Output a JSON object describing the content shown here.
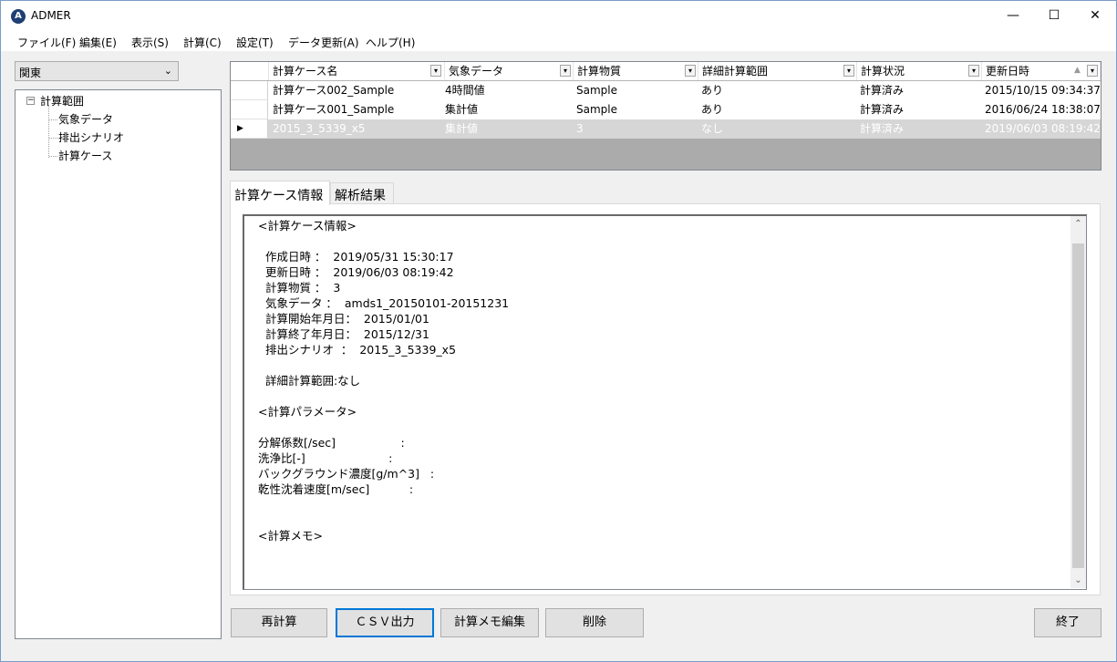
{
  "window": {
    "title": "ADMER",
    "app_icon": "A",
    "controls": {
      "minimize": "—",
      "maximize": "☐",
      "close": "✕"
    }
  },
  "menu": [
    "ファイル(F)",
    "編集(E)",
    "表示(S)",
    "計算(C)",
    "設定(T)",
    "データ更新(A)",
    "ヘルプ(H)"
  ],
  "region_select": {
    "value": "関東"
  },
  "tree": {
    "root": "計算範囲",
    "expander": "−",
    "children": [
      "気象データ",
      "排出シナリオ",
      "計算ケース"
    ]
  },
  "grid": {
    "columns": [
      "計算ケース名",
      "気象データ",
      "計算物質",
      "詳細計算範囲",
      "計算状況",
      "更新日時"
    ],
    "rows": [
      [
        "計算ケース002_Sample",
        "4時間値",
        "Sample",
        "あり",
        "計算済み",
        "2015/10/15 09:34:37"
      ],
      [
        "計算ケース001_Sample",
        "集計値",
        "Sample",
        "あり",
        "計算済み",
        "2016/06/24 18:38:07"
      ],
      [
        "2015_3_5339_x5",
        "集計値",
        "3",
        "なし",
        "計算済み",
        "2019/06/03 08:19:42"
      ]
    ],
    "selected_row": 2
  },
  "tabs": [
    "計算ケース情報",
    "解析結果"
  ],
  "active_tab": 0,
  "info_text": [
    "<計算ケース情報>",
    "",
    "  作成日時 ：  2019/05/31 15:30:17",
    "  更新日時 ：  2019/06/03 08:19:42",
    "  計算物質 ：  3",
    "  気象データ ：  amds1_20150101-20151231",
    "  計算開始年月日：  2015/01/01",
    "  計算終了年月日：  2015/12/31",
    "  排出シナリオ  ：  2015_3_5339_x5",
    "",
    "  詳細計算範囲:なし",
    "",
    "<計算パラメータ>",
    "",
    "分解係数[/sec]                  :",
    "洗浄比[-]                       :",
    "バックグラウンド濃度[g/m^3]   :",
    "乾性沈着速度[m/sec]           :",
    "",
    "",
    "<計算メモ>"
  ],
  "buttons": {
    "recalc": "再計算",
    "csv": "ＣＳＶ出力",
    "memo": "計算メモ編集",
    "delete": "削除",
    "exit": "終了"
  }
}
